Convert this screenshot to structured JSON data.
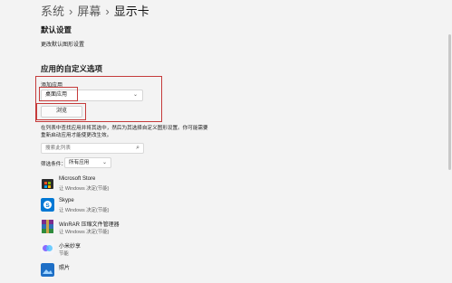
{
  "breadcrumb": {
    "items": [
      "系统",
      "屏幕",
      "显示卡"
    ],
    "separator": "›"
  },
  "default_settings": {
    "heading": "默认设置",
    "link": "更改默认图形设置"
  },
  "custom_options": {
    "heading": "应用的自定义选项",
    "add_app_label": "添加应用",
    "app_type_value": "桌面应用",
    "browse_button": "浏览"
  },
  "list_section": {
    "description": "在列表中查找应用并将其选中，然后为其选择自定义图形设置。你可能需要重新启动应用才能使更改生效。",
    "search_placeholder": "搜索此列表",
    "filter_label": "筛选条件：",
    "filter_value": "所有应用"
  },
  "apps": [
    {
      "name": "Microsoft Store",
      "status": "让 Windows 决定(节能)",
      "icon": "microsoft-store-icon"
    },
    {
      "name": "Skype",
      "status": "让 Windows 决定(节能)",
      "icon": "skype-icon"
    },
    {
      "name": "WinRAR 压缩文件管理器",
      "status": "让 Windows 决定(节能)",
      "icon": "winrar-icon"
    },
    {
      "name": "小米妙享",
      "status": "节能",
      "icon": "xiaomi-share-icon"
    },
    {
      "name": "照片",
      "status": "",
      "icon": "photos-icon"
    }
  ],
  "colors": {
    "highlight_border": "#c53b3b",
    "background": "#f3f3f3"
  }
}
